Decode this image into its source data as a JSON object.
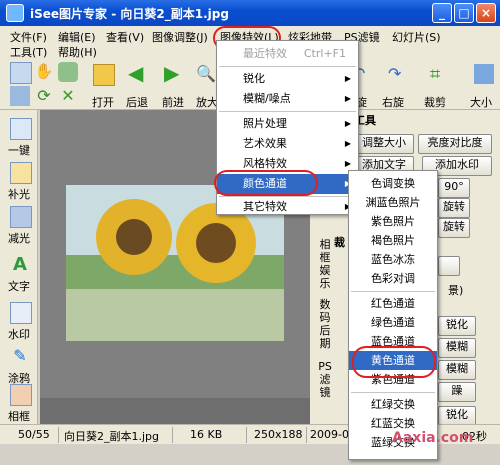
{
  "window": {
    "title": "iSee图片专家 - 向日葵2_副本1.jpg",
    "buttons": [
      "_",
      "□",
      "×"
    ]
  },
  "menubar": {
    "row1": [
      "文件(F)",
      "编辑(E)",
      "查看(V)",
      "图像调整(J)",
      "图像特效(L)",
      "炫彩地带",
      "PS滤镜",
      "幻灯片(S)"
    ],
    "row2": [
      "工具(T)",
      "帮助(H)"
    ]
  },
  "toolbar": {
    "labels": [
      "打开",
      "后退",
      "前进",
      "放大"
    ],
    "right_labels": [
      "旋",
      "右旋",
      "裁剪",
      "大小"
    ]
  },
  "leftbar": {
    "items": [
      "一键",
      "补光",
      "减光",
      "文字",
      "水印",
      "涂鸦",
      "相框"
    ]
  },
  "rightpanel": {
    "section_title": "工具",
    "buttons": [
      "调整大小",
      "亮度对比度",
      "添加文字",
      "添加水印",
      "90°",
      "旋转",
      "旋转"
    ],
    "vertical_labels": [
      "相框娱乐",
      "数码后期",
      "PS滤镜"
    ],
    "partial_labels": [
      "裁",
      "锐化",
      "模糊",
      "模糊",
      "躁",
      "景)",
      "锐化"
    ]
  },
  "menu_effects": {
    "items": [
      {
        "label": "最近特效",
        "shortcut": "Ctrl+F1",
        "disabled": true
      },
      {
        "label": "锐化",
        "arrow": true
      },
      {
        "label": "模糊/噪点",
        "arrow": true
      },
      {
        "label": "照片处理",
        "arrow": true
      },
      {
        "label": "艺术效果",
        "arrow": true
      },
      {
        "label": "风格特效",
        "arrow": true
      },
      {
        "label": "颜色通道",
        "arrow": true,
        "highlighted": true
      },
      {
        "label": "其它特效",
        "arrow": true
      }
    ]
  },
  "menu_channels": {
    "items": [
      "色调变换",
      "渊蓝色照片",
      "紫色照片",
      "褐色照片",
      "蓝色冰冻",
      "色彩对调",
      "红色通道",
      "绿色通道",
      "蓝色通道",
      "黄色通道",
      "紫色通道",
      "红绿交换",
      "红蓝交换",
      "蓝绿交换"
    ],
    "highlighted": "黄色通道"
  },
  "statusbar": {
    "position": "50/55",
    "filename": "向日葵2_副本1.jpg",
    "filesize": "16 KB",
    "dimensions": "250x188",
    "date": "2009-08-01",
    "time": "02秒"
  },
  "watermark": "Aaxia.com",
  "colors": {
    "titlebar": "#0b47c4",
    "highlight": "#316ac5",
    "annotation": "#e02020"
  }
}
